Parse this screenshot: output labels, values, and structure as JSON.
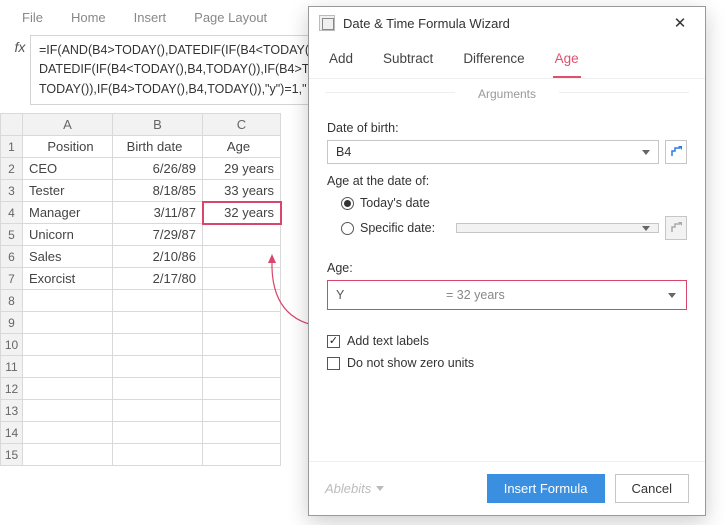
{
  "ribbon": [
    "File",
    "Home",
    "Insert",
    "Page Layout"
  ],
  "formula": "=IF(AND(B4>TODAY(),DATEDIF(IF(B4<TODAY(),B\nDATEDIF(IF(B4<TODAY(),B4,TODAY()),IF(B4>TO\nTODAY()),IF(B4>TODAY(),B4,TODAY()),\"y\")=1,\" \\",
  "columns": [
    "A",
    "B",
    "C"
  ],
  "headers": {
    "A": "Position",
    "B": "Birth date",
    "C": "Age"
  },
  "rows": [
    {
      "n": 2,
      "A": "CEO",
      "B": "6/26/89",
      "C": "29 years"
    },
    {
      "n": 3,
      "A": "Tester",
      "B": "8/18/85",
      "C": "33 years"
    },
    {
      "n": 4,
      "A": "Manager",
      "B": "3/11/87",
      "C": "32 years"
    },
    {
      "n": 5,
      "A": "Unicorn",
      "B": "7/29/87",
      "C": ""
    },
    {
      "n": 6,
      "A": "Sales",
      "B": "2/10/86",
      "C": ""
    },
    {
      "n": 7,
      "A": "Exorcist",
      "B": "2/17/80",
      "C": ""
    }
  ],
  "selected_cell": "C4",
  "wizard": {
    "title": "Date & Time Formula Wizard",
    "tabs": [
      "Add",
      "Subtract",
      "Difference",
      "Age"
    ],
    "active_tab": "Age",
    "arguments_label": "Arguments",
    "dob_label": "Date of birth:",
    "dob_value": "B4",
    "age_at_label": "Age at the date of:",
    "radio_today": "Today's date",
    "radio_specific": "Specific date:",
    "radio_selected": "today",
    "age_label": "Age:",
    "age_unit": "Y",
    "age_result": "= 32 years",
    "chk_labels": "Add text labels",
    "chk_zero": "Do not show zero units",
    "chk_labels_checked": true,
    "chk_zero_checked": false,
    "brand": "Ablebits",
    "btn_insert": "Insert Formula",
    "btn_cancel": "Cancel"
  },
  "accent": "#e04f6e"
}
